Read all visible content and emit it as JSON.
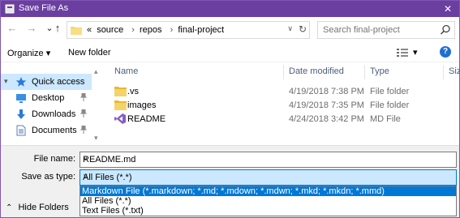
{
  "window": {
    "title": "Save File As",
    "close_glyph": "✕"
  },
  "nav": {
    "back": "←",
    "forward": "→",
    "up": "↑"
  },
  "address": {
    "prefix": "«",
    "crumbs": [
      "source",
      "repos",
      "final-project"
    ],
    "dropdown_glyph": "∨",
    "refresh_glyph": "↻"
  },
  "search": {
    "placeholder": "Search final-project"
  },
  "toolbar": {
    "organize": "Organize ▾",
    "new_folder": "New folder",
    "views_dropdown": "▾",
    "help": "?"
  },
  "navpane": {
    "items": [
      {
        "label": "Quick access",
        "icon": "star-icon"
      },
      {
        "label": "Desktop",
        "icon": "desktop-icon"
      },
      {
        "label": "Downloads",
        "icon": "download-icon"
      },
      {
        "label": "Documents",
        "icon": "documents-icon"
      }
    ]
  },
  "filelist": {
    "columns": [
      "Name",
      "Date modified",
      "Type",
      "Siz"
    ],
    "rows": [
      {
        "name": ".vs",
        "date": "4/19/2018 7:38 PM",
        "type": "File folder",
        "icon": "folder-icon"
      },
      {
        "name": "images",
        "date": "4/19/2018 7:35 PM",
        "type": "File folder",
        "icon": "folder-icon"
      },
      {
        "name": "README",
        "date": "4/24/2018 3:42 PM",
        "type": "MD File",
        "icon": "visual-studio-icon"
      }
    ]
  },
  "form": {
    "filename_label": "File name:",
    "filename_value": "README.md",
    "savetype_label": "Save as type:",
    "savetype_value": "All Files (*.*)",
    "options": [
      "Markdown File (*.markdown; *.md; *.mdown; *.mdwn; *.mkd; *.mkdn; *.mmd)",
      "All Files (*.*)",
      "Text Files (*.txt)"
    ]
  },
  "hide_folders": {
    "chevron": "⌃",
    "label": "Hide Folders"
  },
  "colors": {
    "titlebar": "#6b3fa0",
    "accent": "#0078d7",
    "selection": "#cce8ff"
  }
}
